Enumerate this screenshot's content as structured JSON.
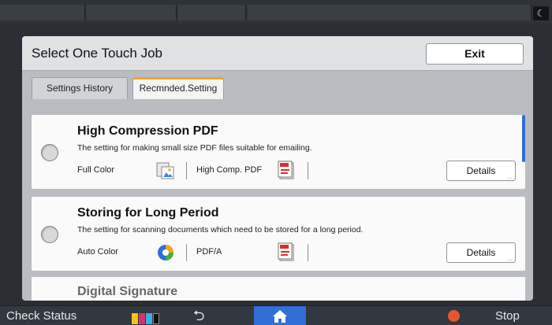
{
  "screen": {
    "title": "Select One Touch Job",
    "exit_label": "Exit"
  },
  "tabs": [
    {
      "label": "Settings History",
      "active": false
    },
    {
      "label": "Recmnded.Setting",
      "active": true
    }
  ],
  "jobs": [
    {
      "title": "High Compression PDF",
      "description": "The setting for making small size PDF files suitable for emailing.",
      "color_mode": "Full Color",
      "color_icon": "full-color-icon",
      "file_type": "High Comp. PDF",
      "file_icon": "pdf-file-icon",
      "details_label": "Details",
      "selected": false
    },
    {
      "title": "Storing for Long Period",
      "description": "The setting for scanning documents which need to be stored for a long period.",
      "color_mode": "Auto Color",
      "color_icon": "auto-color-icon",
      "file_type": "PDF/A",
      "file_icon": "pdf-file-icon",
      "details_label": "Details",
      "selected": false
    },
    {
      "title": "Digital Signature",
      "partial": true
    }
  ],
  "bottom_bar": {
    "check_status_label": "Check Status",
    "toner_icon": "toner-level-icon",
    "back_icon": "back-arrow-icon",
    "home_icon": "home-icon",
    "stop_label": "Stop",
    "stop_icon": "stop-icon"
  },
  "colors": {
    "accent_blue": "#2f6fd6",
    "tab_highlight": "#f0a22c",
    "stop_red": "#e4572e"
  }
}
